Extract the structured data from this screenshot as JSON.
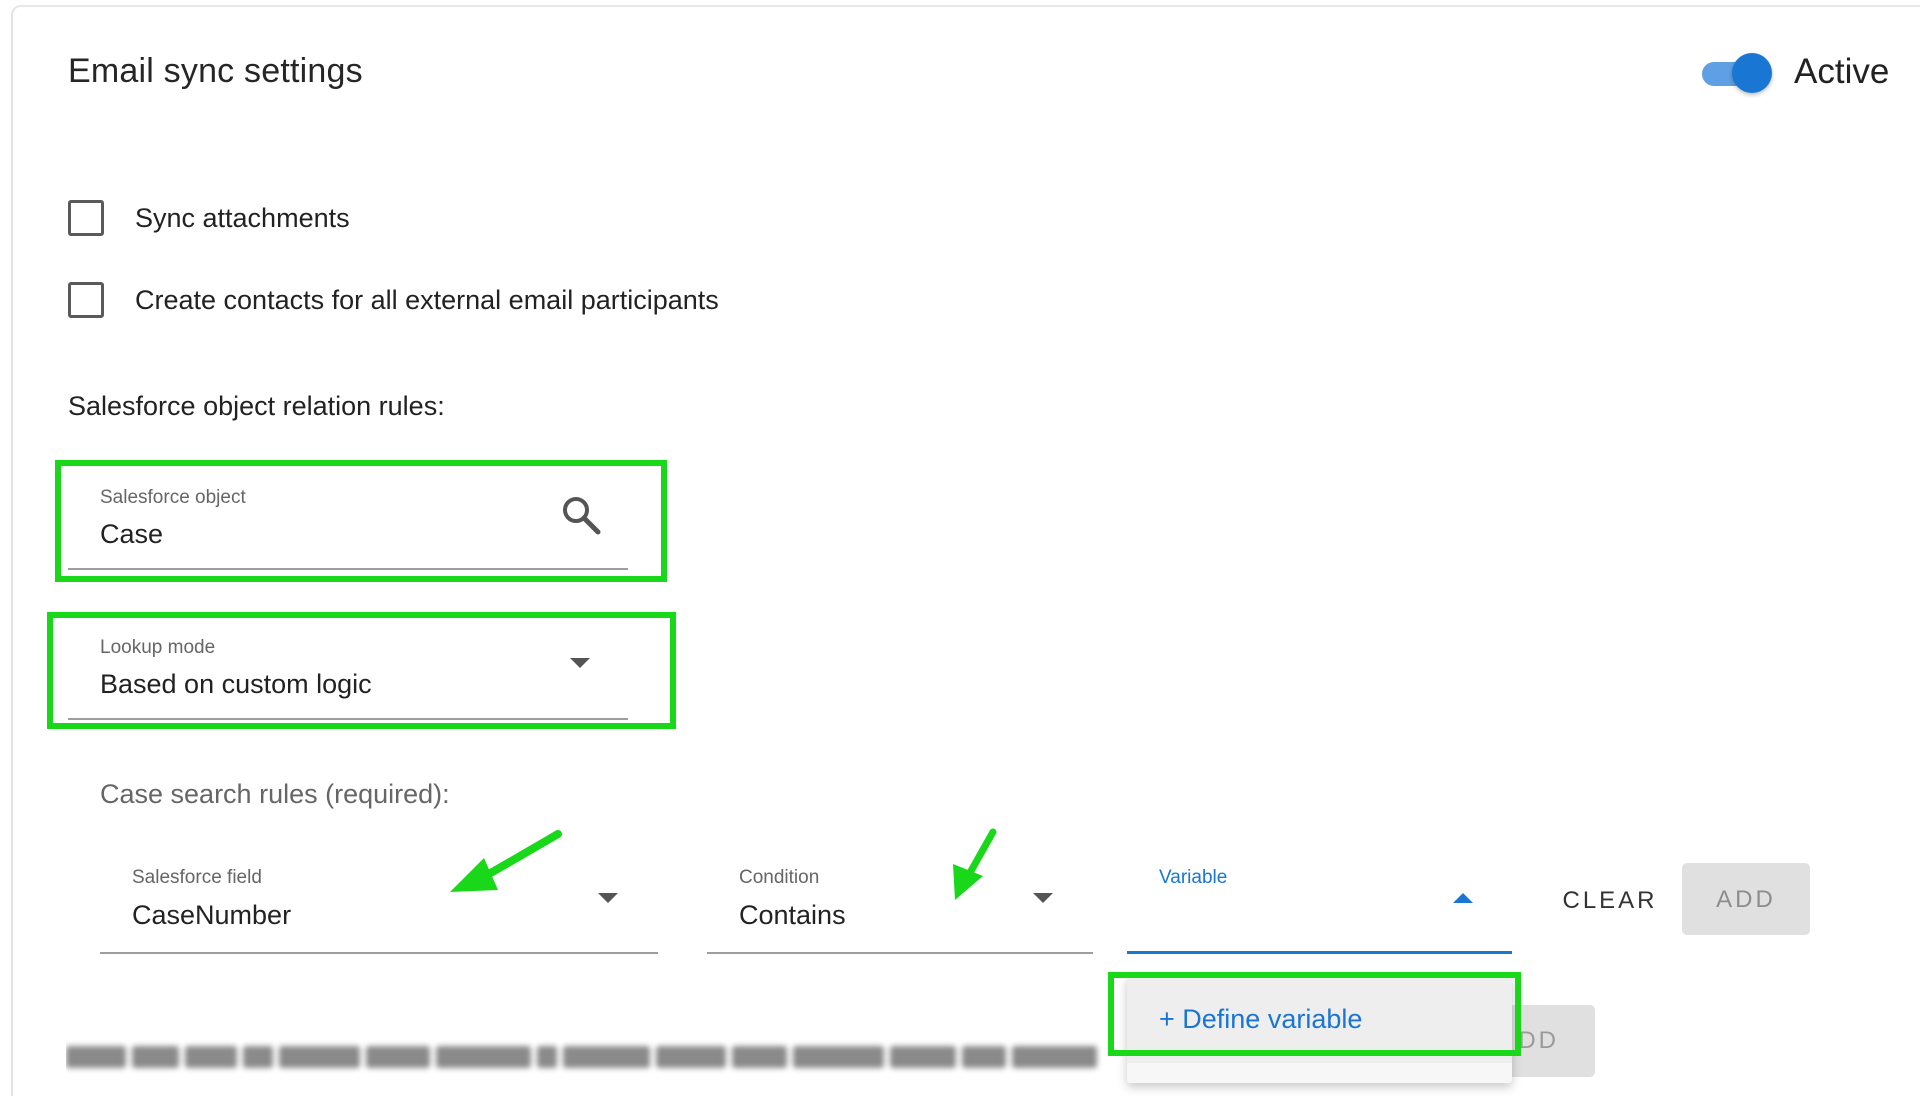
{
  "header": {
    "title": "Email sync settings",
    "toggle_label": "Active",
    "toggle_on": true
  },
  "options": {
    "sync_attachments": {
      "label": "Sync attachments",
      "checked": false
    },
    "create_contacts": {
      "label": "Create contacts for all external email participants",
      "checked": false
    }
  },
  "relation": {
    "section_label": "Salesforce object relation rules:",
    "object_field": {
      "label": "Salesforce object",
      "value": "Case"
    },
    "lookup_field": {
      "label": "Lookup mode",
      "value": "Based on custom logic"
    }
  },
  "rules": {
    "label": "Case search rules (required):",
    "salesforce_field": {
      "label": "Salesforce field",
      "value": "CaseNumber"
    },
    "condition": {
      "label": "Condition",
      "value": "Contains"
    },
    "variable": {
      "label": "Variable",
      "value": ""
    },
    "clear_label": "CLEAR",
    "add_label": "ADD",
    "add_ghost_label": "DD"
  },
  "menu": {
    "define_variable": "+ Define variable"
  },
  "colors": {
    "accent": "#1976d2",
    "highlight": "#19d719",
    "toggle_track": "#5f9fe3"
  }
}
